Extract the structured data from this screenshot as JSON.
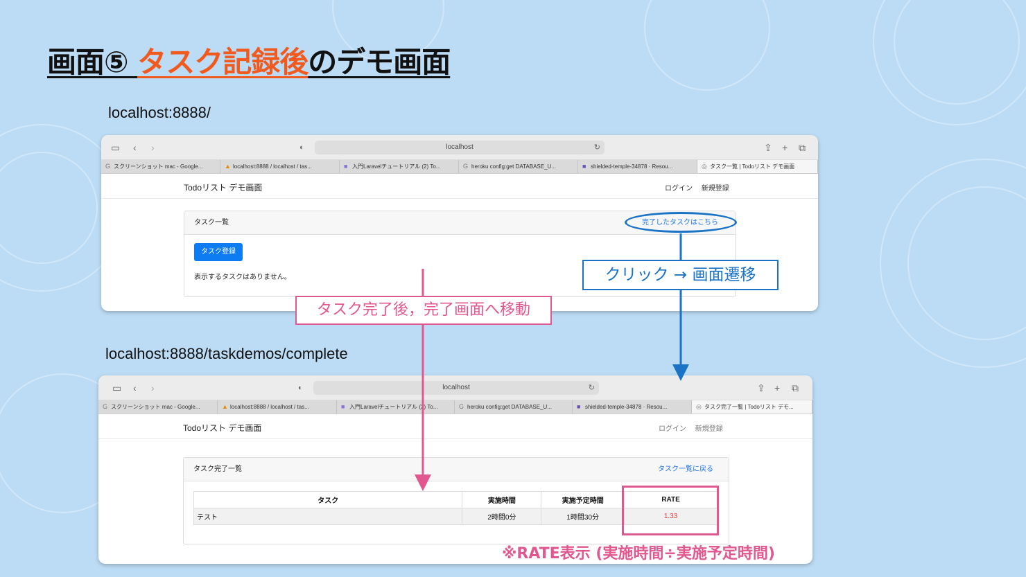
{
  "slide": {
    "title_prefix": "画面⑤ ",
    "title_accent": "タスク記録後",
    "title_suffix": "のデモ画面",
    "url_before": "localhost:8888/",
    "url_after": "localhost:8888/taskdemos/complete"
  },
  "browser": {
    "address": "localhost",
    "tabs": [
      {
        "label": "スクリーンショット mac - Google...",
        "icon": "google-icon"
      },
      {
        "label": "localhost:8888 / localhost / tas...",
        "icon": "phpmyadmin-icon"
      },
      {
        "label": "入門Laravelチュートリアル (2) To...",
        "icon": "laravel-doc-icon"
      },
      {
        "label": "heroku config:get DATABASE_U...",
        "icon": "google-icon"
      },
      {
        "label": "shielded-temple-34878 · Resou...",
        "icon": "heroku-icon"
      }
    ],
    "active_tab_before": "タスク一覧 | Todoリスト デモ画面",
    "active_tab_after": "タスク完了一覧 | Todoリスト デモ..."
  },
  "app": {
    "brand": "Todoリスト デモ画面",
    "login": "ログイン",
    "register": "新規登録"
  },
  "screen_before": {
    "card_title": "タスク一覧",
    "completed_link": "完了したタスクはこちら",
    "add_button": "タスク登録",
    "empty_message": "表示するタスクはありません。"
  },
  "screen_after": {
    "card_title": "タスク完了一覧",
    "back_link": "タスク一覧に戻る",
    "table": {
      "headers": [
        "タスク",
        "実施時間",
        "実施予定時間",
        "RATE"
      ],
      "rows": [
        [
          "テスト",
          "2時間0分",
          "1時間30分",
          "1.33"
        ]
      ]
    }
  },
  "annotations": {
    "click_note": "クリック → 画面遷移",
    "move_note": "タスク完了後，完了画面へ移動",
    "rate_note": "※RATE表示 (実施時間÷実施予定時間)"
  },
  "colors": {
    "accent_orange": "#f05a1e",
    "annotation_blue": "#1a73c4",
    "annotation_pink": "#e0588f",
    "primary_button": "#0d7cf2",
    "rate_red": "#e53935",
    "background": "#bcdcf5"
  }
}
